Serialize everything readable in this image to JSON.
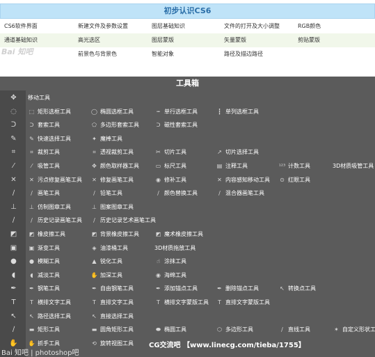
{
  "header": {
    "title": "初步认识CS6",
    "nav_rows": [
      [
        "CS6软件界面",
        "新建文件及参数设置",
        "图层基础知识",
        "文件的打开及大小调整",
        "RGB颜色"
      ],
      [
        "通道基础知识",
        "高光选区",
        "图层蒙版",
        "矢量蒙版",
        "剪贴蒙版"
      ],
      [
        "",
        "前景色与背景色",
        "智能对象",
        "路径及描边路径",
        ""
      ]
    ]
  },
  "watermark_top": "Bai 知吧",
  "toolbox": {
    "title": "工具箱",
    "rows": [
      {
        "icon": "move-icon",
        "glyph": "✥",
        "items": [
          {
            "icon": "",
            "glyph": "",
            "label": "移动工具"
          }
        ]
      },
      {
        "icon": "marquee-icon",
        "glyph": "◌",
        "items": [
          {
            "glyph": "⬚",
            "label": "矩形选框工具"
          },
          {
            "glyph": "◯",
            "label": "椭圆选框工具"
          },
          {
            "glyph": "┅",
            "label": "单行选框工具"
          },
          {
            "glyph": "┇",
            "label": "单列选框工具"
          }
        ]
      },
      {
        "icon": "lasso-icon",
        "glyph": "ᑐ",
        "items": [
          {
            "glyph": "ᑐ",
            "label": "套索工具"
          },
          {
            "glyph": "⬠",
            "label": "多边形套索工具"
          },
          {
            "glyph": "ᑐ",
            "label": "磁性套索工具"
          }
        ]
      },
      {
        "icon": "quick-select-icon",
        "glyph": "✎",
        "items": [
          {
            "glyph": "✎",
            "label": "快速选择工具"
          },
          {
            "glyph": "✦",
            "label": "魔棒工具"
          }
        ]
      },
      {
        "icon": "crop-icon",
        "glyph": "⌗",
        "items": [
          {
            "glyph": "⌗",
            "label": "裁剪工具"
          },
          {
            "glyph": "⌗",
            "label": "透视裁剪工具"
          },
          {
            "glyph": "✂",
            "label": "切片工具"
          },
          {
            "glyph": "↗",
            "label": "切片选择工具"
          }
        ]
      },
      {
        "icon": "eyedropper-icon",
        "glyph": "⁄",
        "items": [
          {
            "glyph": "⁄",
            "label": "吸管工具"
          },
          {
            "glyph": "✥",
            "label": "颜色取样器工具"
          },
          {
            "glyph": "▭",
            "label": "标尺工具"
          },
          {
            "glyph": "▤",
            "label": "注释工具"
          },
          {
            "glyph": "¹²³",
            "label": "计数工具"
          },
          {
            "glyph": "",
            "label": "3D材质吸管工具"
          }
        ]
      },
      {
        "icon": "healing-icon",
        "glyph": "✕",
        "items": [
          {
            "glyph": "✕",
            "label": "污点修复画笔工具"
          },
          {
            "glyph": "✕",
            "label": "修复画笔工具"
          },
          {
            "glyph": "◉",
            "label": "修补工具"
          },
          {
            "glyph": "✕",
            "label": "内容感知移动工具"
          },
          {
            "glyph": "⊙",
            "label": "红眼工具"
          }
        ]
      },
      {
        "icon": "brush-icon",
        "glyph": "∕",
        "items": [
          {
            "glyph": "∕",
            "label": "画笔工具"
          },
          {
            "glyph": "∕",
            "label": "铅笔工具"
          },
          {
            "glyph": "∕",
            "label": "颜色替换工具"
          },
          {
            "glyph": "∕",
            "label": "混合器画笔工具"
          }
        ]
      },
      {
        "icon": "stamp-icon",
        "glyph": "⊥",
        "items": [
          {
            "glyph": "⊥",
            "label": "仿制图章工具"
          },
          {
            "glyph": "⊥",
            "label": "图案图章工具"
          }
        ]
      },
      {
        "icon": "history-brush-icon",
        "glyph": "∕",
        "items": [
          {
            "glyph": "∕",
            "label": "历史记录画笔工具"
          },
          {
            "glyph": "∕",
            "label": "历史记录艺术画笔工具"
          }
        ]
      },
      {
        "icon": "eraser-icon",
        "glyph": "◩",
        "items": [
          {
            "glyph": "◩",
            "label": "橡皮擦工具"
          },
          {
            "glyph": "◩",
            "label": "背景橡皮擦工具"
          },
          {
            "glyph": "◩",
            "label": "魔术橡皮擦工具"
          }
        ]
      },
      {
        "icon": "gradient-icon",
        "glyph": "▣",
        "items": [
          {
            "glyph": "▣",
            "label": "渐变工具"
          },
          {
            "glyph": "◈",
            "label": "油漆桶工具"
          },
          {
            "glyph": "",
            "label": "3D材质拖放工具"
          }
        ]
      },
      {
        "icon": "blur-icon",
        "glyph": "●",
        "items": [
          {
            "glyph": "●",
            "label": "模糊工具"
          },
          {
            "glyph": "▲",
            "label": "锐化工具"
          },
          {
            "glyph": "☝",
            "label": "涂抹工具"
          }
        ]
      },
      {
        "icon": "dodge-icon",
        "glyph": "◖",
        "items": [
          {
            "glyph": "◖",
            "label": "减淡工具"
          },
          {
            "glyph": "✋",
            "label": "加深工具"
          },
          {
            "glyph": "◉",
            "label": "海绵工具"
          }
        ]
      },
      {
        "icon": "pen-icon",
        "glyph": "✒",
        "items": [
          {
            "glyph": "✒",
            "label": "钢笔工具"
          },
          {
            "glyph": "✒",
            "label": "自由钢笔工具"
          },
          {
            "glyph": "✒",
            "label": "添加锚点工具"
          },
          {
            "glyph": "✒",
            "label": "删除锚点工具"
          },
          {
            "glyph": "↖",
            "label": "转换点工具"
          }
        ]
      },
      {
        "icon": "type-icon",
        "glyph": "T",
        "items": [
          {
            "glyph": "T",
            "label": "横排文字工具"
          },
          {
            "glyph": "T",
            "label": "直排文字工具"
          },
          {
            "glyph": "T",
            "label": "横排文字蒙版工具"
          },
          {
            "glyph": "T",
            "label": "直排文字蒙版工具"
          }
        ]
      },
      {
        "icon": "path-select-icon",
        "glyph": "↖",
        "items": [
          {
            "glyph": "↖",
            "label": "路径选择工具"
          },
          {
            "glyph": "↖",
            "label": "直接选择工具"
          }
        ]
      },
      {
        "icon": "shape-icon",
        "glyph": "∕",
        "items": [
          {
            "glyph": "▬",
            "label": "矩形工具"
          },
          {
            "glyph": "▬",
            "label": "圆角矩形工具"
          },
          {
            "glyph": "⬬",
            "label": "椭圆工具"
          },
          {
            "glyph": "⬡",
            "label": "多边形工具"
          },
          {
            "glyph": "∕",
            "label": "直线工具"
          },
          {
            "glyph": "✶",
            "label": "自定义形状工具"
          }
        ]
      },
      {
        "icon": "hand-icon",
        "glyph": "✋",
        "items": [
          {
            "glyph": "✋",
            "label": "抓手工具"
          },
          {
            "glyph": "⟲",
            "label": "旋转视图工具"
          }
        ]
      }
    ]
  },
  "watermark_site": "CG交流吧 【www.linecg.com/tieba/1755】",
  "watermark_bottom": "Bai 知吧 | photoshop吧"
}
